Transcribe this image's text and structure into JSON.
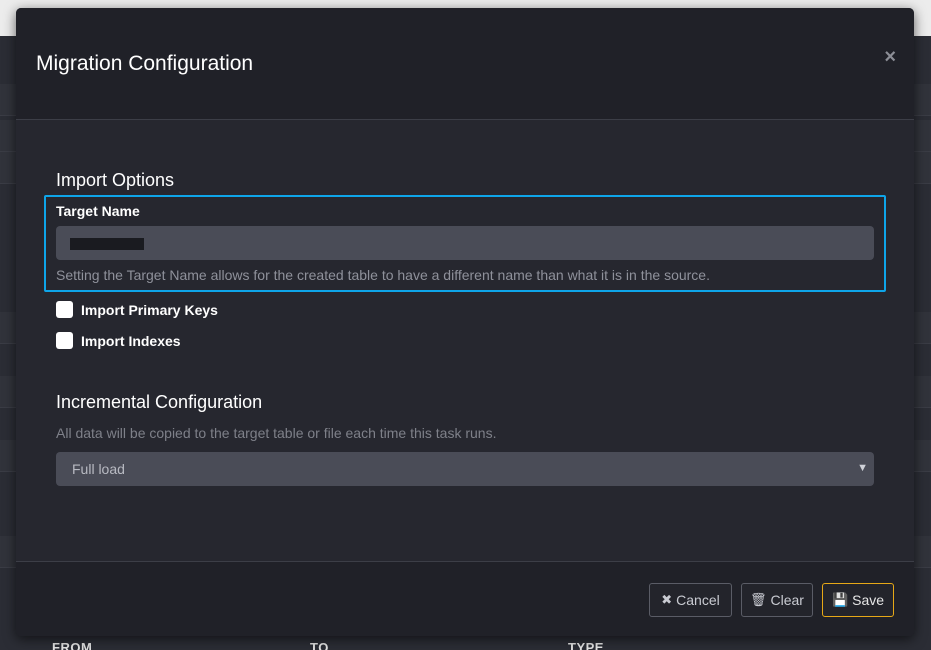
{
  "modal": {
    "title": "Migration Configuration",
    "close_label": "×"
  },
  "import_options": {
    "section_title": "Import Options",
    "target_name_label": "Target Name",
    "target_name_value": "",
    "target_name_help": "Setting the Target Name allows for the created table to have a different name than what it is in the source.",
    "checkboxes": [
      {
        "label": "Import Primary Keys",
        "checked": false
      },
      {
        "label": "Import Indexes",
        "checked": false
      }
    ]
  },
  "incremental": {
    "section_title": "Incremental Configuration",
    "help": "All data will be copied to the target table or file each time this task runs.",
    "selected": "Full load"
  },
  "footer": {
    "cancel_label": "Cancel",
    "clear_label": "Clear",
    "save_label": "Save"
  },
  "background_columns": [
    "FROM",
    "TO",
    "TYPE"
  ],
  "colors": {
    "focus_border": "#0ea5e9",
    "save_border": "#e6a817"
  }
}
